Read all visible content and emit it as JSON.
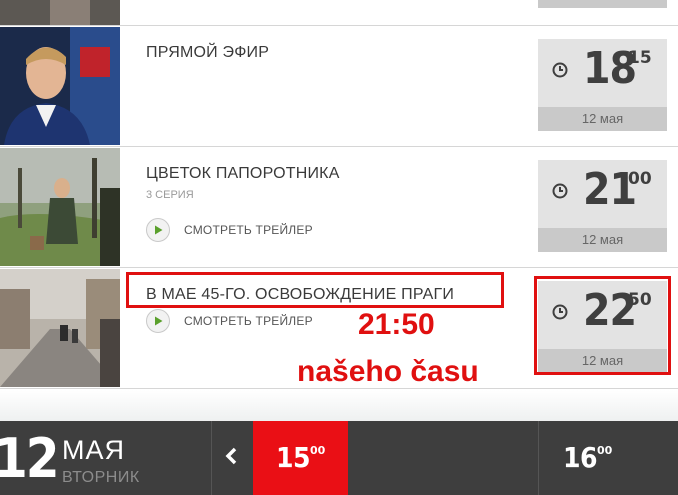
{
  "programs": [
    {
      "title": "ПРЯМОЙ ЭФИР",
      "subtitle": "",
      "trailer_label": "",
      "time_hh": "18",
      "time_mm": "15",
      "date": "12 мая"
    },
    {
      "title": "ЦВЕТОК ПАПОРОТНИКА",
      "subtitle": "3 СЕРИЯ",
      "trailer_label": "СМОТРЕТЬ ТРЕЙЛЕР",
      "time_hh": "21",
      "time_mm": "00",
      "date": "12 мая"
    },
    {
      "title": "В МАЕ 45-ГО. ОСВОБОЖДЕНИЕ ПРАГИ",
      "subtitle": "",
      "trailer_label": "СМОТРЕТЬ ТРЕЙЛЕР",
      "time_hh": "22",
      "time_mm": "50",
      "date": "12 мая"
    }
  ],
  "annotation": {
    "line1": "21:50",
    "line2": "našeho času",
    "color": "#e01010"
  },
  "datebar": {
    "day": "12",
    "month": "МАЯ",
    "weekday": "ВТОРНИК",
    "slots": [
      {
        "hh": "15",
        "mm": "00",
        "active": true
      },
      {
        "hh": "16",
        "mm": "00",
        "active": false
      }
    ],
    "accent": "#ea0f15"
  },
  "icons": {
    "clock": "clock-icon",
    "play": "play-icon",
    "prev": "chevron-left-icon"
  }
}
